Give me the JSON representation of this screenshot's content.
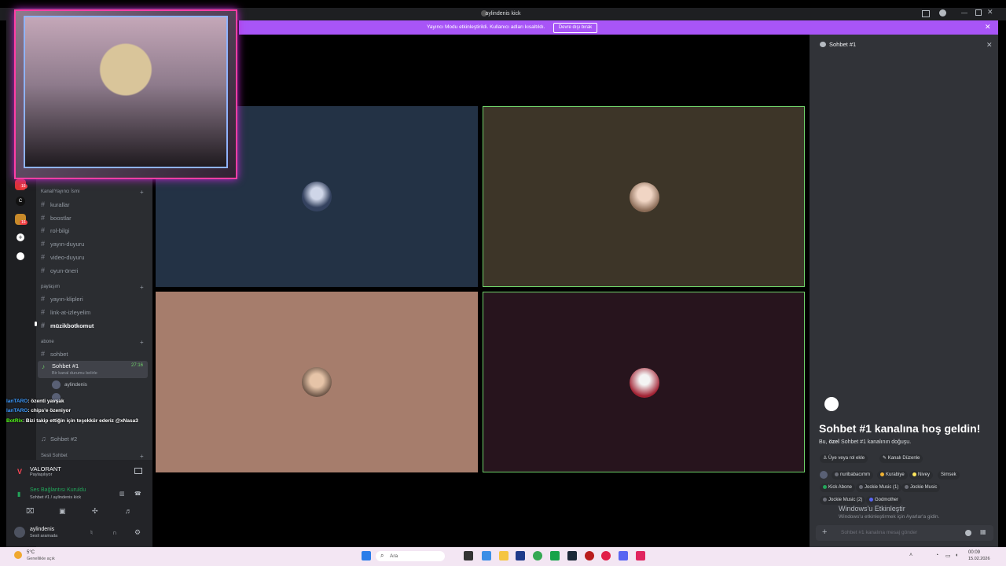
{
  "window": {
    "title": "aylindenis kick"
  },
  "banner": {
    "text": "Yayıncı Modu etkinleştirildi. Kullanıcı adları kısaltıldı.",
    "button": "Devre dışı bırak"
  },
  "guild_badges": [
    "16",
    "16"
  ],
  "channels": {
    "cat1": "Kanal/Yayıncı İsmi",
    "list1": [
      "kurallar",
      "boostlar",
      "rol-bilgi",
      "yayın-duyuru",
      "video-duyuru",
      "oyun-öneri"
    ],
    "cat2": "paylaşım",
    "list2": [
      "yayın-klipleri",
      "link-at-izleyelim",
      "müzikbotkomut"
    ],
    "cat3": "abone",
    "list3": [
      "sohbet"
    ],
    "active": {
      "name": "Sohbet #1",
      "time": "27:16",
      "sub": "Bir kanal durumu belirle",
      "user": "aylindenis"
    },
    "ch2": "Sohbet #2",
    "cat4": "Sesli Sohbet"
  },
  "overlay_chat": [
    {
      "user": "lanTARO",
      "msg": ": özenti yavşak"
    },
    {
      "user": "lanTARO",
      "msg": ": chips'e özeniyor"
    },
    {
      "user": "BotRix",
      "msg": ": Bizi takip ettiğin için teşekkür ederiz @xNasa3"
    }
  ],
  "voice": {
    "game": "VALORANT",
    "game_sub": "Paylaşılıyor",
    "status": "Ses Bağlantısı Kuruldu",
    "status_sub": "Sohbet #1 / aylindenis kick",
    "username": "aylindenis",
    "user_sub": "Sesli aramada"
  },
  "chat": {
    "title": "Sohbet #1",
    "welcome": "Sohbet #1 kanalına hoş geldin!",
    "sub_prefix": "Bu, ",
    "sub_bold": "özel",
    "sub_suffix": " Sohbet #1 kanalının doğuşu.",
    "btn1": "Üye veya rol ekle",
    "btn2": "Kanalı Düzenle",
    "tags": [
      "nuribabacımm",
      "Kurabiye",
      "Nivey",
      "Simsek",
      "Kick Abone",
      "Jockie Music (1)",
      "Jockie Music",
      "Jockie Music (2)",
      "Godmother"
    ],
    "input_placeholder": "Sohbet #1 kanalına mesaj gönder"
  },
  "activation": {
    "title": "Windows'u Etkinleştir",
    "sub": "Windows'u etkinleştirmek için Ayarlar'a gidin."
  },
  "taskbar": {
    "weather_temp": "5°C",
    "weather_desc": "Genellikle açık",
    "search": "Ara",
    "time": "00:09",
    "date": "15.02.2026"
  },
  "colors": {
    "accent": "#a855f7",
    "tile1": "#233245",
    "tile2": "#3d3528",
    "tile3": "#a67d6c",
    "tile4": "#27141d",
    "speaking": "#6fd26a"
  }
}
